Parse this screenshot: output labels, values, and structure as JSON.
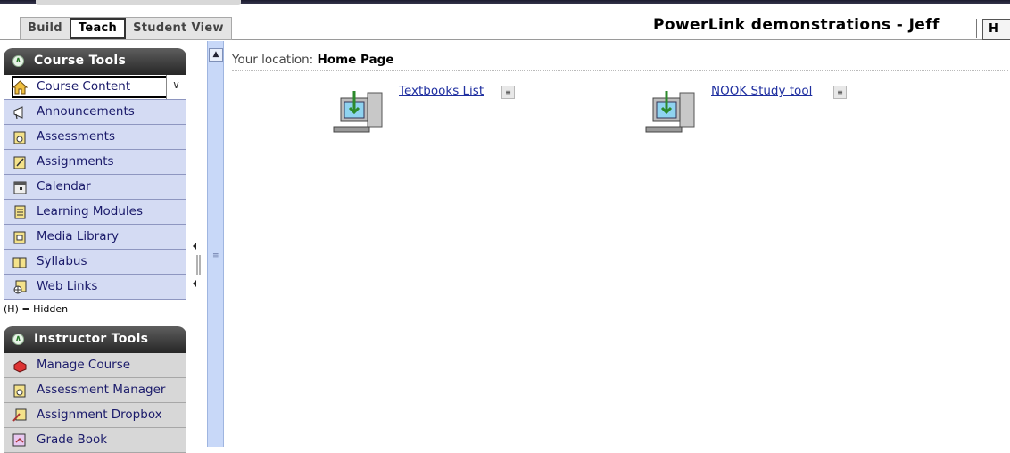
{
  "tabs": [
    {
      "label": "Build"
    },
    {
      "label": "Teach"
    },
    {
      "label": "Student View"
    }
  ],
  "active_tab": "Teach",
  "course_title": "PowerLink demonstrations - Jeff",
  "help_button": "H",
  "course_tools": {
    "title": "Course Tools",
    "items": [
      {
        "label": "Course Content"
      },
      {
        "label": "Announcements"
      },
      {
        "label": "Assessments"
      },
      {
        "label": "Assignments"
      },
      {
        "label": "Calendar"
      },
      {
        "label": "Learning Modules"
      },
      {
        "label": "Media Library"
      },
      {
        "label": "Syllabus"
      },
      {
        "label": "Web Links"
      }
    ]
  },
  "hidden_note": "(H) = Hidden",
  "instructor_tools": {
    "title": "Instructor Tools",
    "items": [
      {
        "label": "Manage Course"
      },
      {
        "label": "Assessment Manager"
      },
      {
        "label": "Assignment Dropbox"
      },
      {
        "label": "Grade Book"
      }
    ]
  },
  "location": {
    "prefix": "Your location:",
    "page": "Home Page"
  },
  "content_links": [
    {
      "label": "Textbooks List",
      "icon": "computer-download-icon"
    },
    {
      "label": "NOOK Study tool",
      "icon": "computer-download-icon"
    }
  ],
  "colors": {
    "nav_blue": "#d4dbf3",
    "nav_gray": "#d7d7d7",
    "link": "#1f2fa0",
    "header_dark": "#262626"
  }
}
